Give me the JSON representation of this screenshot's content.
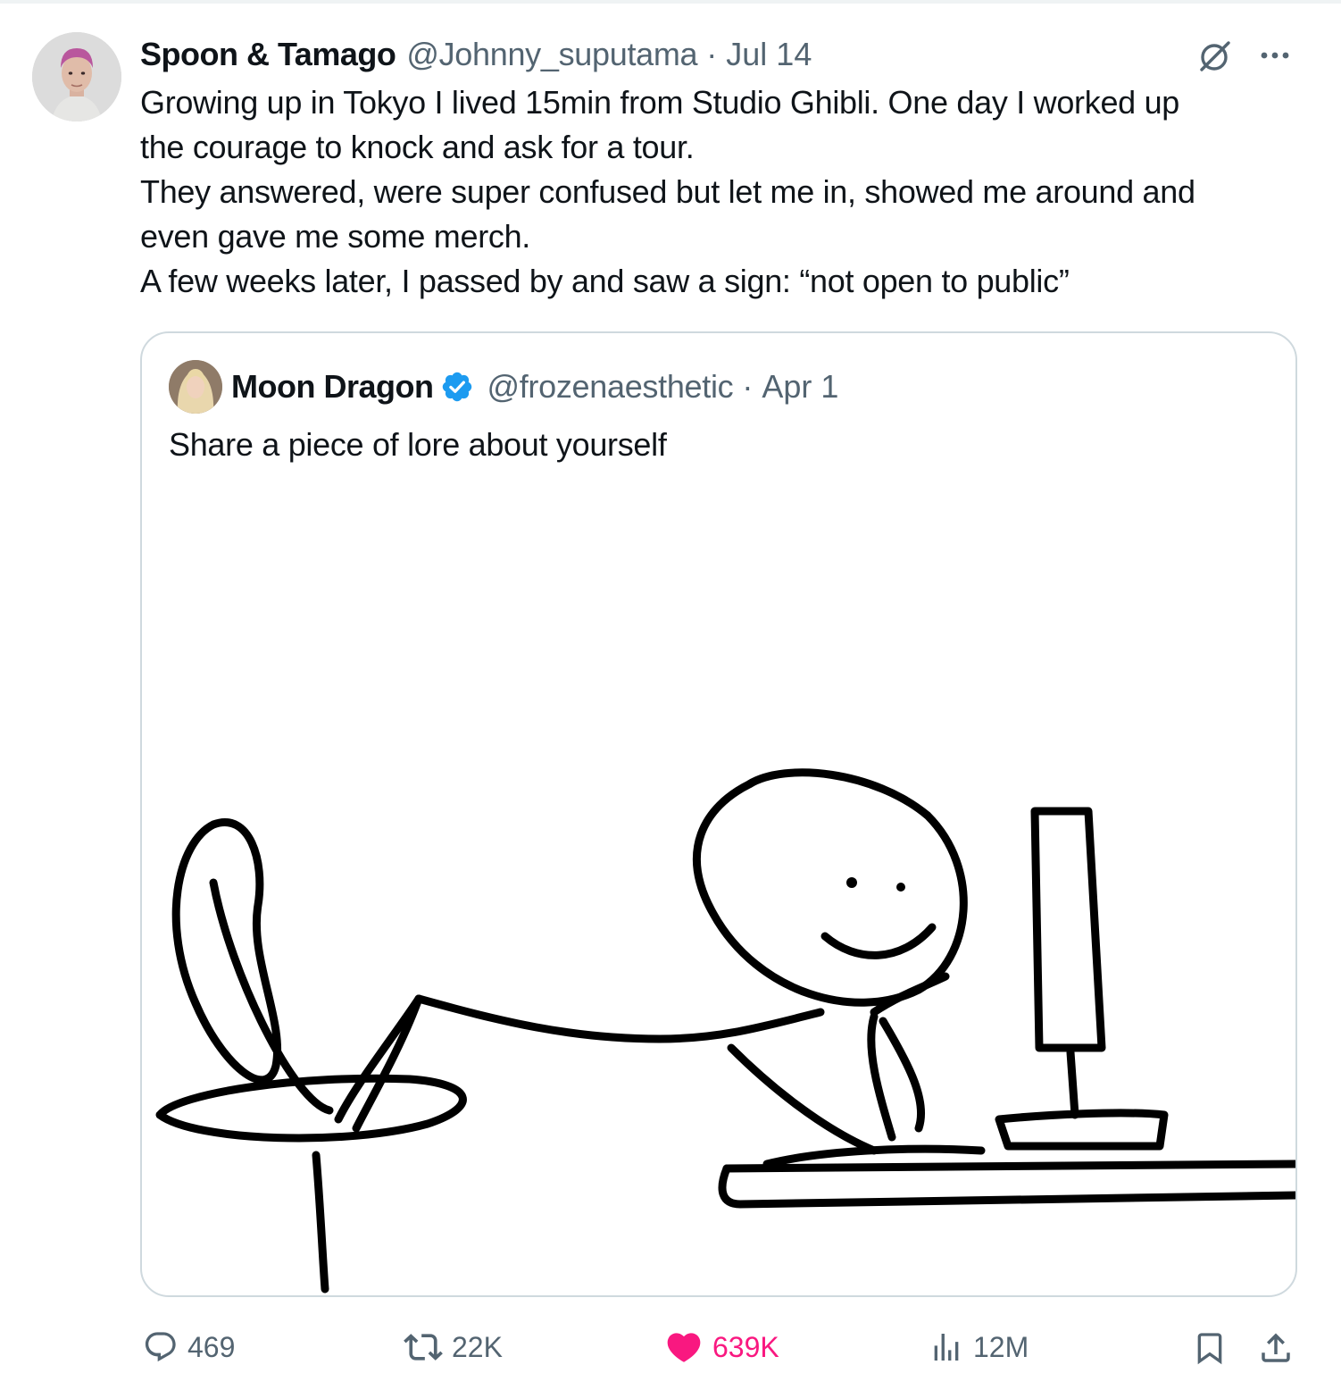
{
  "tweet": {
    "display_name": "Spoon & Tamago",
    "handle": "@Johnny_suputama",
    "separator": "·",
    "date": "Jul 14",
    "text_lines": [
      "Growing up in Tokyo I lived 15min from Studio Ghibli. One day I worked up",
      "the courage to knock and ask for a tour.",
      "They answered, were super confused but let me in, showed me around and",
      "even gave me some merch.",
      "A few weeks later, I passed by and saw a sign: “not open to public”"
    ]
  },
  "quote": {
    "display_name": "Moon Dragon",
    "verified": true,
    "handle": "@frozenaesthetic",
    "separator": "·",
    "date": "Apr 1",
    "text": "Share a piece of lore about yourself",
    "media": "stick-figure-at-computer"
  },
  "actions": {
    "replies": "469",
    "reposts": "22K",
    "likes": "639K",
    "views": "12M"
  },
  "colors": {
    "text": "#0f1419",
    "secondary": "#536471",
    "border": "#cfd9de",
    "like": "#f91880",
    "verified": "#1d9bf0"
  },
  "icons": [
    "grok-icon",
    "more-icon",
    "verified-icon",
    "reply-icon",
    "repost-icon",
    "like-icon",
    "views-icon",
    "bookmark-icon",
    "share-icon"
  ]
}
